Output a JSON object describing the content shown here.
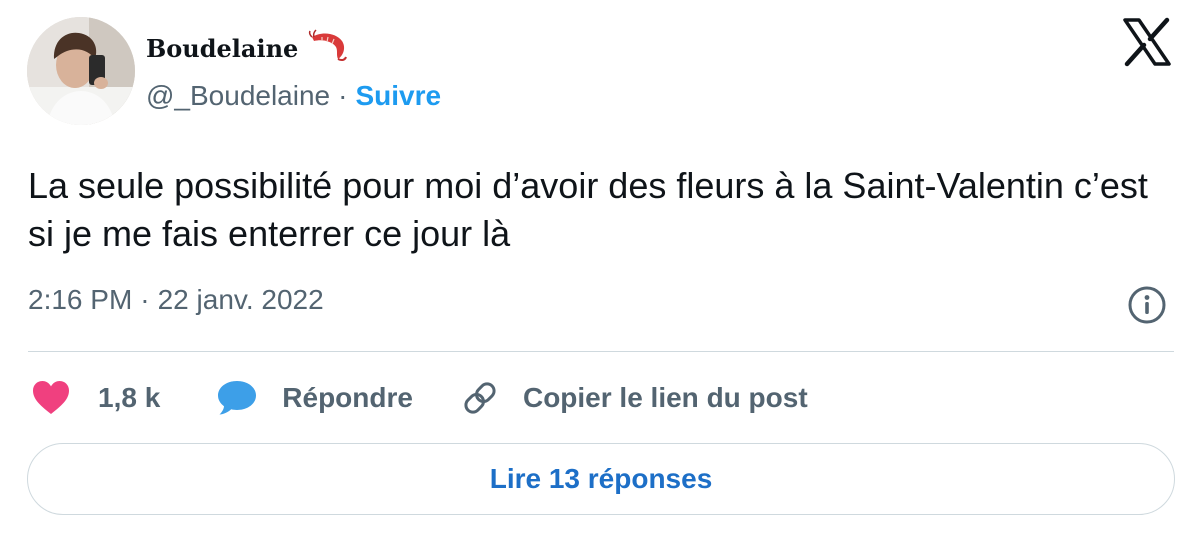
{
  "author": {
    "display_name": "Boudelaine",
    "name_emoji": "shrimp-icon",
    "handle": "@_Boudelaine",
    "separator": "·",
    "follow_label": "Suivre"
  },
  "tweet": {
    "text": "La seule possibilité pour moi d’avoir des fleurs à la Saint-Valentin c’est si je me fais enterrer ce jour là",
    "time": "2:16 PM",
    "separator": "·",
    "date": "22 janv. 2022"
  },
  "actions": {
    "likes_count": "1,8 k",
    "reply_label": "Répondre",
    "copy_link_label": "Copier le lien du post"
  },
  "read_replies_label": "Lire 13 réponses",
  "colors": {
    "accent": "#1d9bf0",
    "like": "#f0407f",
    "reply": "#3d9fe8",
    "secondary_text": "#536471",
    "read_replies_text": "#1d6fc7"
  }
}
